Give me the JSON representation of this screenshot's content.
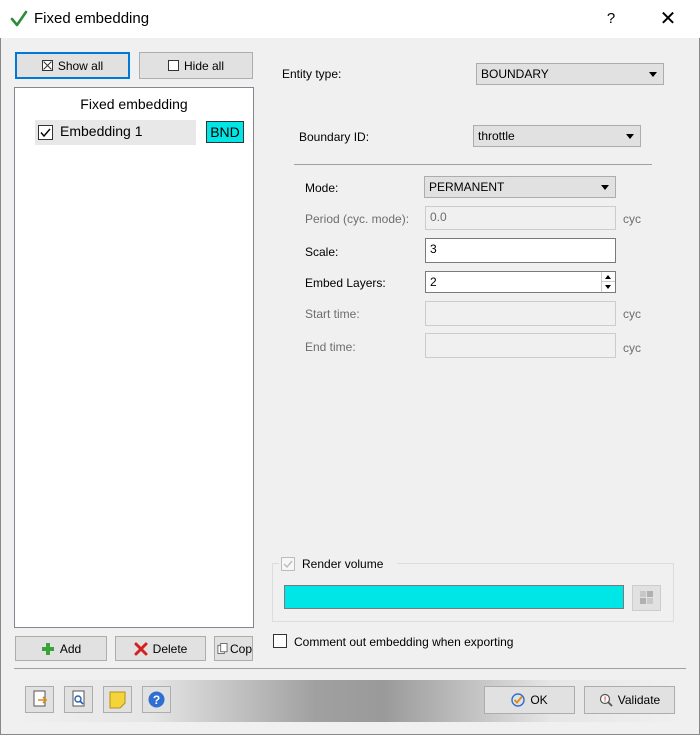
{
  "window": {
    "title": "Fixed embedding",
    "help_label": "?",
    "close_label": "✕"
  },
  "left": {
    "show_all_label": "Show all",
    "hide_all_label": "Hide all",
    "list_header": "Fixed embedding",
    "items": [
      {
        "label": "Embedding 1",
        "checked": true,
        "badge": "BND",
        "badge_color": "#00e5e5"
      }
    ],
    "add_label": "Add",
    "delete_label": "Delete",
    "copy_label": "Cop"
  },
  "right": {
    "entity_type_label": "Entity type:",
    "entity_type_value": "BOUNDARY",
    "boundary_id_label": "Boundary ID:",
    "boundary_id_value": "throttle",
    "mode_label": "Mode:",
    "mode_value": "PERMANENT",
    "period_label": "Period (cyc. mode):",
    "period_value": "0.0",
    "period_unit": "cyc",
    "scale_label": "Scale:",
    "scale_value": "3",
    "embed_layers_label": "Embed Layers:",
    "embed_layers_value": "2",
    "start_time_label": "Start time:",
    "start_time_unit": "cyc",
    "end_time_label": "End time:",
    "end_time_unit": "cyc",
    "render_volume_label": "Render volume",
    "render_color": "#00e6e6",
    "comment_out_label": "Comment out embedding when exporting"
  },
  "footer": {
    "ok_label": "OK",
    "validate_label": "Validate"
  }
}
